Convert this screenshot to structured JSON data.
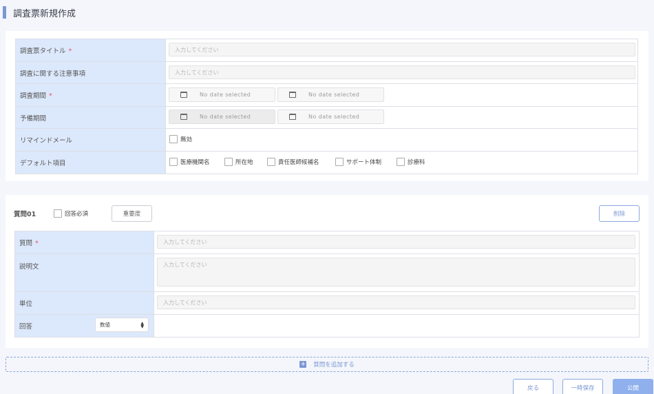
{
  "page": {
    "title": "調査票新規作成"
  },
  "survey_form": {
    "rows": {
      "title": {
        "label": "調査票タイトル",
        "required_mark": "*",
        "placeholder": "入力してください"
      },
      "notes": {
        "label": "調査に関する注意事項",
        "placeholder": "入力してください"
      },
      "period": {
        "label": "調査期間",
        "required_mark": "*",
        "start": "No date selected",
        "end": "No date selected"
      },
      "reserve_period": {
        "label": "予備期間",
        "start": "No date selected",
        "end": "No date selected"
      },
      "reminder": {
        "label": "リマインドメール",
        "option": "無効"
      },
      "defaults": {
        "label": "デフォルト項目",
        "options": [
          "医療機関名",
          "所在地",
          "責任医師候補名",
          "サポート体制",
          "診療科"
        ]
      }
    }
  },
  "question": {
    "number_label": "質問01",
    "required_label": "回答必須",
    "importance_button": "重要度",
    "delete_button": "削除",
    "rows": {
      "question": {
        "label": "質問",
        "required_mark": "*",
        "placeholder": "入力してください"
      },
      "description": {
        "label": "説明文",
        "placeholder": "入力してください"
      },
      "unit": {
        "label": "単位",
        "placeholder": "入力してください"
      },
      "answer": {
        "label": "回答",
        "type_selected": "数値"
      }
    }
  },
  "add_question": {
    "label": "質問を追加する",
    "icon": "plus-icon"
  },
  "footer": {
    "back": "戻る",
    "save_draft": "一時保存",
    "publish": "公開"
  },
  "colors": {
    "accent": "#7b97d4",
    "label_bg": "#dce8fb",
    "required": "#e05a6e",
    "publish_bg": "#8fb0ec"
  }
}
